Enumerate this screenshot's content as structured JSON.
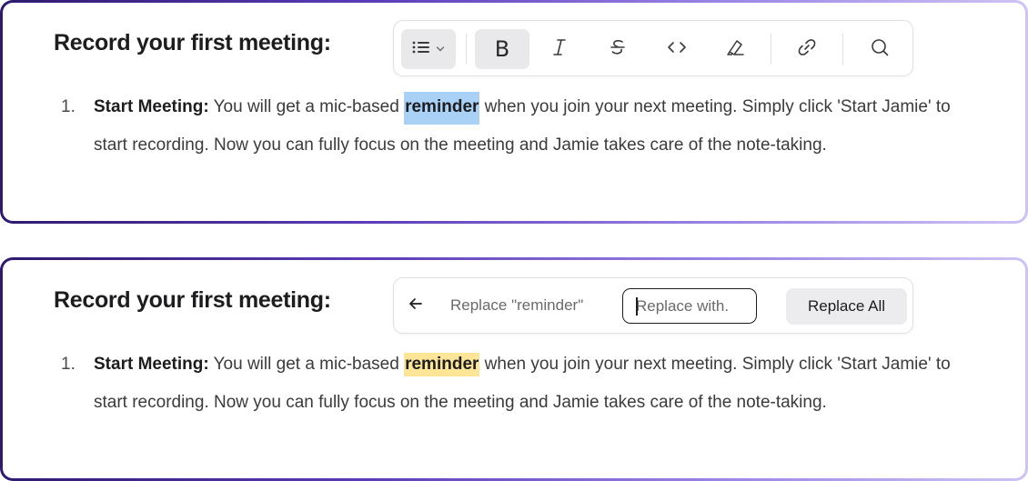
{
  "panel_top": {
    "heading": "Record your first meeting:",
    "toolbar": {
      "list_icon": "bulleted-list-icon",
      "dropdown_icon": "chevron-down-icon",
      "bold_label": "B",
      "icons": [
        "bold-icon",
        "italic-icon",
        "strikethrough-icon",
        "code-icon",
        "highlight-icon",
        "link-icon",
        "search-icon"
      ]
    },
    "list_item": {
      "number": "1.",
      "label": "Start Meeting:",
      "text_before": " You will get a mic-based ",
      "highlighted_word": "reminder",
      "text_after": " when you join your next meeting. Simply click 'Start Jamie' to start recording. Now you can fully focus on the meeting and Jamie takes care of the note-taking."
    }
  },
  "panel_bottom": {
    "heading": "Record your first meeting:",
    "replace_bar": {
      "back_icon": "arrow-left-icon",
      "find_label": "Replace \"reminder\"",
      "replace_placeholder": "Replace with.",
      "replace_all_label": "Replace All"
    },
    "list_item": {
      "number": "1.",
      "label": "Start Meeting:",
      "text_before": " You will get a mic-based ",
      "highlighted_word": "reminder",
      "text_after": " when you join your next meeting. Simply click 'Start Jamie' to start recording. Now you can fully focus on the meeting and Jamie takes care of the note-taking."
    }
  },
  "colors": {
    "selection_highlight": "#a9d0f5",
    "search_match_highlight": "#fde597",
    "border_gradient_start": "#2e1a6e",
    "border_gradient_end": "#cfc3f4"
  }
}
